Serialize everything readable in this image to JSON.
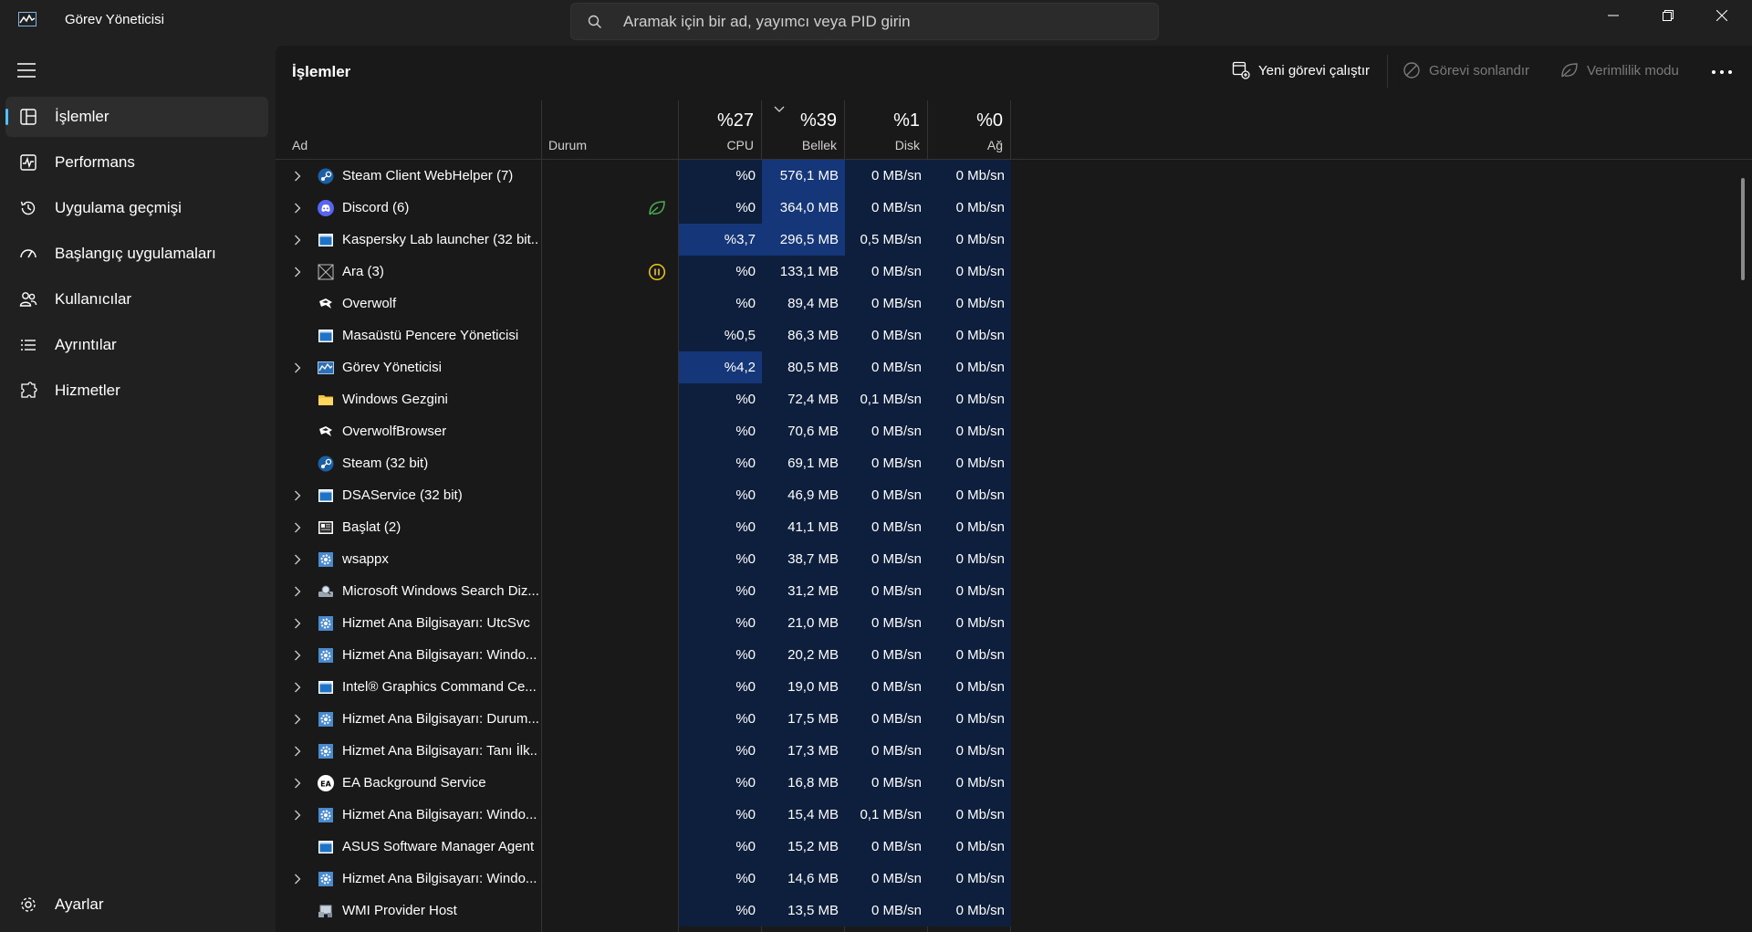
{
  "window": {
    "title": "Görev Yöneticisi",
    "search_placeholder": "Aramak için bir ad, yayımcı veya PID girin"
  },
  "sidebar": {
    "items": [
      {
        "label": "İşlemler",
        "icon": "processes-icon",
        "active": true
      },
      {
        "label": "Performans",
        "icon": "performance-icon"
      },
      {
        "label": "Uygulama geçmişi",
        "icon": "history-icon"
      },
      {
        "label": "Başlangıç uygulamaları",
        "icon": "startup-icon"
      },
      {
        "label": "Kullanıcılar",
        "icon": "users-icon"
      },
      {
        "label": "Ayrıntılar",
        "icon": "details-icon"
      },
      {
        "label": "Hizmetler",
        "icon": "services-icon"
      }
    ],
    "settings_label": "Ayarlar"
  },
  "toolbar": {
    "page_title": "İşlemler",
    "run_new_task": "Yeni görevi çalıştır",
    "end_task": "Görevi sonlandır",
    "efficiency_mode": "Verimlilik modu"
  },
  "table": {
    "columns": {
      "name": "Ad",
      "status": "Durum",
      "cpu": {
        "percent": "%27",
        "label": "CPU"
      },
      "memory": {
        "percent": "%39",
        "label": "Bellek"
      },
      "disk": {
        "percent": "%1",
        "label": "Disk"
      },
      "network": {
        "percent": "%0",
        "label": "Ağ"
      }
    },
    "rows": [
      {
        "name": "Steam Client WebHelper (7)",
        "expandable": true,
        "icon": "steam-icon",
        "status": "",
        "cpu": "%0",
        "memory": "576,1 MB",
        "disk": "0 MB/sn",
        "network": "0 Mb/sn"
      },
      {
        "name": "Discord (6)",
        "expandable": true,
        "icon": "discord-icon",
        "status": "efficiency-leaf-icon",
        "cpu": "%0",
        "memory": "364,0 MB",
        "disk": "0 MB/sn",
        "network": "0 Mb/sn"
      },
      {
        "name": "Kaspersky Lab launcher (32 bit...",
        "expandable": true,
        "icon": "app-window-icon",
        "status": "",
        "cpu": "%3,7",
        "memory": "296,5 MB",
        "disk": "0,5 MB/sn",
        "network": "0 Mb/sn"
      },
      {
        "name": "Ara (3)",
        "expandable": true,
        "icon": "placeholder-icon",
        "status": "paused-icon",
        "cpu": "%0",
        "memory": "133,1 MB",
        "disk": "0 MB/sn",
        "network": "0 Mb/sn"
      },
      {
        "name": "Overwolf",
        "expandable": false,
        "icon": "overwolf-icon",
        "status": "",
        "cpu": "%0",
        "memory": "89,4 MB",
        "disk": "0 MB/sn",
        "network": "0 Mb/sn"
      },
      {
        "name": "Masaüstü Pencere Yöneticisi",
        "expandable": false,
        "icon": "app-window-icon",
        "status": "",
        "cpu": "%0,5",
        "memory": "86,3 MB",
        "disk": "0 MB/sn",
        "network": "0 Mb/sn"
      },
      {
        "name": "Görev Yöneticisi",
        "expandable": true,
        "icon": "task-manager-icon",
        "status": "",
        "cpu": "%4,2",
        "memory": "80,5 MB",
        "disk": "0 MB/sn",
        "network": "0 Mb/sn"
      },
      {
        "name": "Windows Gezgini",
        "expandable": false,
        "icon": "folder-icon",
        "status": "",
        "cpu": "%0",
        "memory": "72,4 MB",
        "disk": "0,1 MB/sn",
        "network": "0 Mb/sn"
      },
      {
        "name": "OverwolfBrowser",
        "expandable": false,
        "icon": "overwolf-icon",
        "status": "",
        "cpu": "%0",
        "memory": "70,6 MB",
        "disk": "0 MB/sn",
        "network": "0 Mb/sn"
      },
      {
        "name": "Steam (32 bit)",
        "expandable": false,
        "icon": "steam-icon",
        "status": "",
        "cpu": "%0",
        "memory": "69,1 MB",
        "disk": "0 MB/sn",
        "network": "0 Mb/sn"
      },
      {
        "name": "DSAService (32 bit)",
        "expandable": true,
        "icon": "app-window-icon",
        "status": "",
        "cpu": "%0",
        "memory": "46,9 MB",
        "disk": "0 MB/sn",
        "network": "0 Mb/sn"
      },
      {
        "name": "Başlat (2)",
        "expandable": true,
        "icon": "start-icon",
        "status": "",
        "cpu": "%0",
        "memory": "41,1 MB",
        "disk": "0 MB/sn",
        "network": "0 Mb/sn"
      },
      {
        "name": "wsappx",
        "expandable": true,
        "icon": "service-gear-icon",
        "status": "",
        "cpu": "%0",
        "memory": "38,7 MB",
        "disk": "0 MB/sn",
        "network": "0 Mb/sn"
      },
      {
        "name": "Microsoft Windows Search Diz...",
        "expandable": true,
        "icon": "search-indexer-icon",
        "status": "",
        "cpu": "%0",
        "memory": "31,2 MB",
        "disk": "0 MB/sn",
        "network": "0 Mb/sn"
      },
      {
        "name": "Hizmet Ana Bilgisayarı: UtcSvc",
        "expandable": true,
        "icon": "service-gear-icon",
        "status": "",
        "cpu": "%0",
        "memory": "21,0 MB",
        "disk": "0 MB/sn",
        "network": "0 Mb/sn"
      },
      {
        "name": "Hizmet Ana Bilgisayarı: Windo...",
        "expandable": true,
        "icon": "service-gear-icon",
        "status": "",
        "cpu": "%0",
        "memory": "20,2 MB",
        "disk": "0 MB/sn",
        "network": "0 Mb/sn"
      },
      {
        "name": "Intel® Graphics Command Ce...",
        "expandable": true,
        "icon": "app-window-icon",
        "status": "",
        "cpu": "%0",
        "memory": "19,0 MB",
        "disk": "0 MB/sn",
        "network": "0 Mb/sn"
      },
      {
        "name": "Hizmet Ana Bilgisayarı: Durum...",
        "expandable": true,
        "icon": "service-gear-icon",
        "status": "",
        "cpu": "%0",
        "memory": "17,5 MB",
        "disk": "0 MB/sn",
        "network": "0 Mb/sn"
      },
      {
        "name": "Hizmet Ana Bilgisayarı: Tanı İlk...",
        "expandable": true,
        "icon": "service-gear-icon",
        "status": "",
        "cpu": "%0",
        "memory": "17,3 MB",
        "disk": "0 MB/sn",
        "network": "0 Mb/sn"
      },
      {
        "name": "EA Background Service",
        "expandable": true,
        "icon": "ea-icon",
        "status": "",
        "cpu": "%0",
        "memory": "16,8 MB",
        "disk": "0 MB/sn",
        "network": "0 Mb/sn"
      },
      {
        "name": "Hizmet Ana Bilgisayarı: Windo...",
        "expandable": true,
        "icon": "service-gear-icon",
        "status": "",
        "cpu": "%0",
        "memory": "15,4 MB",
        "disk": "0,1 MB/sn",
        "network": "0 Mb/sn"
      },
      {
        "name": "ASUS Software Manager Agent",
        "expandable": false,
        "icon": "app-window-icon",
        "status": "",
        "cpu": "%0",
        "memory": "15,2 MB",
        "disk": "0 MB/sn",
        "network": "0 Mb/sn"
      },
      {
        "name": "Hizmet Ana Bilgisayarı: Windo...",
        "expandable": true,
        "icon": "service-gear-icon",
        "status": "",
        "cpu": "%0",
        "memory": "14,6 MB",
        "disk": "0 MB/sn",
        "network": "0 Mb/sn"
      },
      {
        "name": "WMI Provider Host",
        "expandable": false,
        "icon": "wmi-icon",
        "status": "",
        "cpu": "%0",
        "memory": "13,5 MB",
        "disk": "0 MB/sn",
        "network": "0 Mb/sn"
      }
    ]
  },
  "colors": {
    "accent": "#4cc2ff",
    "heat_low": "#0e1f3d",
    "heat_mid": "#112a55",
    "heat_high": "#153779"
  }
}
